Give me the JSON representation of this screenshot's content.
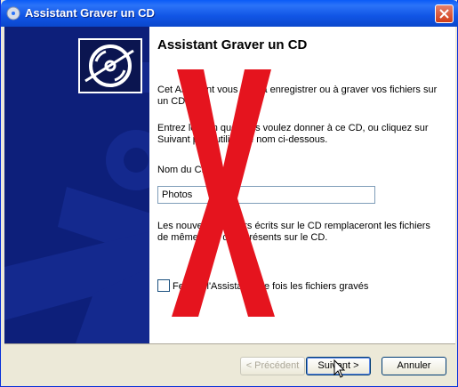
{
  "window": {
    "title": "Assistant Graver un CD"
  },
  "page": {
    "heading": "Assistant Graver un CD",
    "intro": "Cet Assistant vous aide à enregistrer ou à graver vos fichiers sur un CD.",
    "instruction": "Entrez le nom que vous voulez donner à ce CD, ou cliquez sur Suivant pour utiliser le nom ci-dessous.",
    "name_label": "Nom du CD :",
    "name_value": "Photos",
    "warning": "Les nouveaux fichiers écrits sur le CD remplaceront les fichiers de même nom déjà présents sur le CD.",
    "checkbox_label": "Fermer l'Assistant une fois les fichiers gravés"
  },
  "buttons": {
    "back": "< Précédent",
    "next": "Suivant >",
    "cancel": "Annuler"
  },
  "colors": {
    "overlay_x": "#e5141e",
    "sidebar": "#0d1f7a",
    "titlebar": "#0a5bf7"
  },
  "icons": {
    "title": "cd-burn-icon",
    "close": "close-icon",
    "wizard": "cd-disc-icon"
  }
}
